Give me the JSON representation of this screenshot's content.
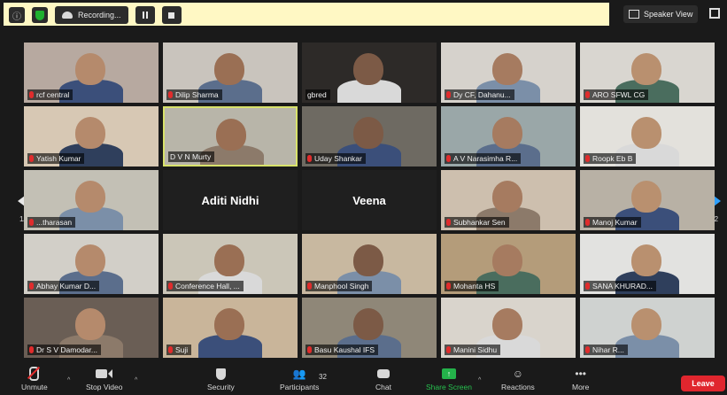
{
  "topbar": {
    "recording_label": "Recording...",
    "view_label": "Speaker View"
  },
  "pagination": {
    "left": "1/2",
    "right": "1/2"
  },
  "tiles": [
    {
      "name": "rcf central",
      "muted": true
    },
    {
      "name": "Dilip Sharma",
      "muted": true
    },
    {
      "name": "gbred",
      "muted": false
    },
    {
      "name": "Dy CF, Dahanu...",
      "muted": true
    },
    {
      "name": "ARO SFWL CG",
      "muted": true
    },
    {
      "name": "Yatish Kumar",
      "muted": true
    },
    {
      "name": "D V N Murty",
      "muted": false
    },
    {
      "name": "Uday Shankar",
      "muted": true
    },
    {
      "name": "A V Narasimha R...",
      "muted": true
    },
    {
      "name": "Roopk Eb B",
      "muted": true
    },
    {
      "name": "...tharasan",
      "muted": true
    },
    {
      "name": "Aditi Nidhi",
      "muted": false
    },
    {
      "name": "Veena",
      "muted": false
    },
    {
      "name": "Subhankar Sen",
      "muted": true
    },
    {
      "name": "Manoj Kumar",
      "muted": true
    },
    {
      "name": "Abhay Kumar D...",
      "muted": true
    },
    {
      "name": "Conference Hall, ...",
      "muted": true
    },
    {
      "name": "Manphool Singh",
      "muted": true
    },
    {
      "name": "Mohanta HS",
      "muted": true
    },
    {
      "name": "SANA KHURAD...",
      "muted": true
    },
    {
      "name": "Dr S V Damodar...",
      "muted": true
    },
    {
      "name": "Suji",
      "muted": true
    },
    {
      "name": "Basu Kaushal IFS",
      "muted": true
    },
    {
      "name": "Manini Sidhu",
      "muted": true
    },
    {
      "name": "Nihar R...",
      "muted": true
    }
  ],
  "toolbar": {
    "unmute": "Unmute",
    "stop_video": "Stop Video",
    "security": "Security",
    "participants": "Participants",
    "participants_count": "32",
    "chat": "Chat",
    "share_screen": "Share Screen",
    "reactions": "Reactions",
    "more": "More",
    "leave": "Leave"
  },
  "colors": {
    "active_speaker_border": "#d8e26b",
    "share_green": "#24b24a",
    "leave_red": "#e0262e",
    "recording_banner": "#fff8c4"
  }
}
